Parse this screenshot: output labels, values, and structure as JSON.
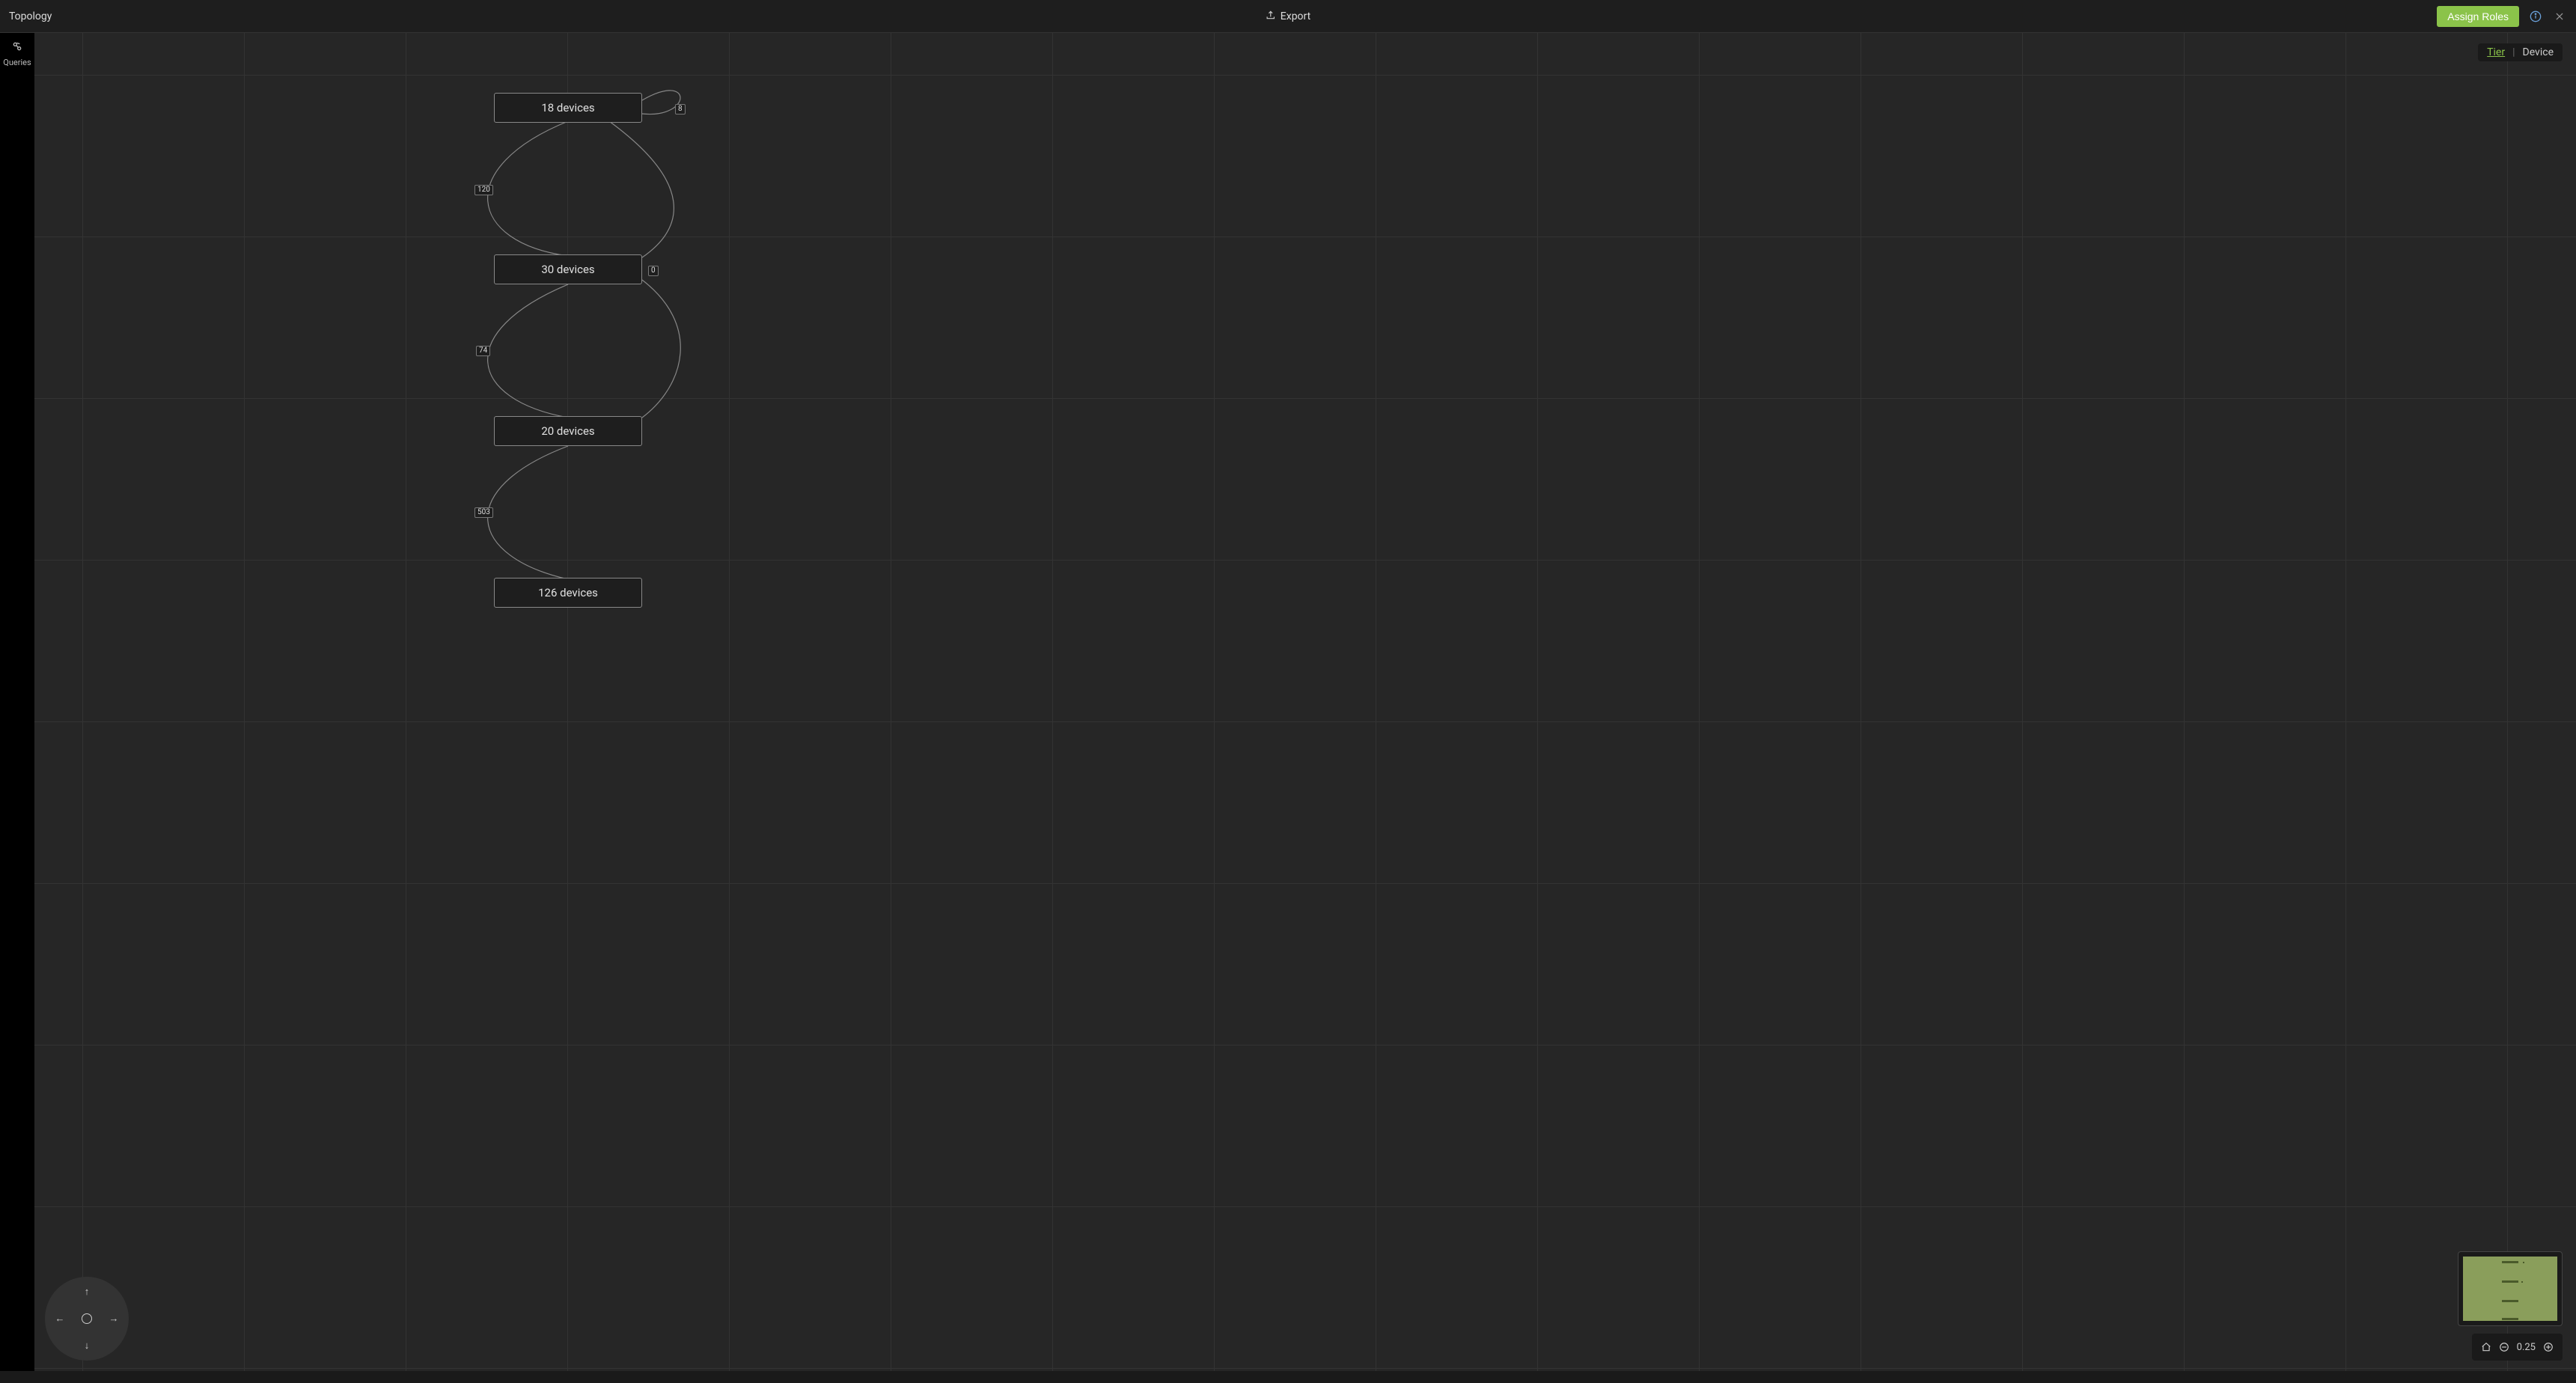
{
  "header": {
    "title": "Topology",
    "export_label": "Export",
    "assign_roles_label": "Assign Roles"
  },
  "rail": {
    "queries_label": "Queries"
  },
  "view_toggle": {
    "tier_label": "Tier",
    "device_label": "Device",
    "separator": "|"
  },
  "tiers": [
    {
      "label": "18 devices"
    },
    {
      "label": "30 devices"
    },
    {
      "label": "20 devices"
    },
    {
      "label": "126 devices"
    }
  ],
  "edges": {
    "self_loop_1": "8",
    "link_1_2_left": "120",
    "link_1_2_right": "0",
    "link_2_3_left": "74",
    "link_3_4_left": "503"
  },
  "zoom": {
    "level": "0.25"
  }
}
